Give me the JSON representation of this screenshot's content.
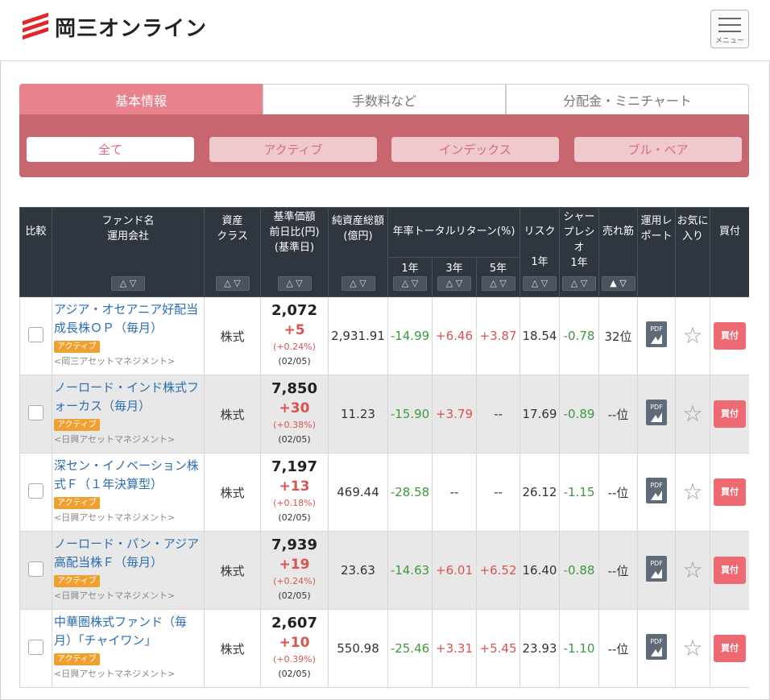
{
  "header": {
    "logo_text": "岡三オンライン",
    "menu_label": "メニュー"
  },
  "tabs": [
    {
      "label": "基本情報",
      "active": true
    },
    {
      "label": "手数料など",
      "active": false
    },
    {
      "label": "分配金・ミニチャート",
      "active": false
    }
  ],
  "filters": [
    {
      "label": "全て",
      "active": true
    },
    {
      "label": "アクティブ",
      "active": false
    },
    {
      "label": "インデックス",
      "active": false
    },
    {
      "label": "ブル・ベア",
      "active": false
    }
  ],
  "table": {
    "headers": {
      "compare": "比較",
      "fund_line1": "ファンド名",
      "fund_line2": "運用会社",
      "asset_line1": "資産",
      "asset_line2": "クラス",
      "nav_line1": "基準価額",
      "nav_line2": "前日比(円)",
      "nav_line3": "(基準日)",
      "assets_line1": "純資産総額",
      "assets_line2": "(億円)",
      "return_group": "年率トータルリターン(%)",
      "ret_1y": "1年",
      "ret_3y": "3年",
      "ret_5y": "5年",
      "risk_line1": "リスク",
      "risk_line2": "1年",
      "sharpe_line1": "シャー",
      "sharpe_line2": "プレシ",
      "sharpe_line3": "オ",
      "sharpe_line4": "1年",
      "ranking": "売れ筋",
      "report_line1": "運用レ",
      "report_line2": "ポート",
      "fav_line1": "お気に",
      "fav_line2": "入り",
      "buy": "買付",
      "sort_symbol": "△ ▽",
      "sort_active_symbol": "▲ ▽"
    },
    "rows": [
      {
        "name_line1": "アジア・オセアニア好配当",
        "name_line2": "成長株ＯＰ（毎月）",
        "badge": "アクティブ",
        "company": "<岡三アセットマネジメント>",
        "asset_class": "株式",
        "nav": "2,072",
        "change": "+5",
        "change_pct": "(+0.24%)",
        "date": "(02/05)",
        "net_assets": "2,931.91",
        "ret_1y": "-14.99",
        "ret_3y": "+6.46",
        "ret_5y": "+3.87",
        "risk": "18.54",
        "sharpe": "-0.78",
        "rank": "32位",
        "buy": "買付"
      },
      {
        "name_line1": "ノーロード・インド株式フ",
        "name_line2": "ォーカス（毎月）",
        "badge": "アクティブ",
        "company": "<日興アセットマネジメント>",
        "asset_class": "株式",
        "nav": "7,850",
        "change": "+30",
        "change_pct": "(+0.38%)",
        "date": "(02/05)",
        "net_assets": "11.23",
        "ret_1y": "-15.90",
        "ret_3y": "+3.79",
        "ret_5y": "--",
        "risk": "17.69",
        "sharpe": "-0.89",
        "rank": "--位",
        "buy": "買付"
      },
      {
        "name_line1": "深セン・イノベーション株",
        "name_line2": "式Ｆ（１年決算型）",
        "badge": "アクティブ",
        "company": "<日興アセットマネジメント>",
        "asset_class": "株式",
        "nav": "7,197",
        "change": "+13",
        "change_pct": "(+0.18%)",
        "date": "(02/05)",
        "net_assets": "469.44",
        "ret_1y": "-28.58",
        "ret_3y": "--",
        "ret_5y": "--",
        "risk": "26.12",
        "sharpe": "-1.15",
        "rank": "--位",
        "buy": "買付"
      },
      {
        "name_line1": "ノーロード・パン・アジア",
        "name_line2": "高配当株Ｆ（毎月）",
        "badge": "アクティブ",
        "company": "<日興アセットマネジメント>",
        "asset_class": "株式",
        "nav": "7,939",
        "change": "+19",
        "change_pct": "(+0.24%)",
        "date": "(02/05)",
        "net_assets": "23.63",
        "ret_1y": "-14.63",
        "ret_3y": "+6.01",
        "ret_5y": "+6.52",
        "risk": "16.40",
        "sharpe": "-0.88",
        "rank": "--位",
        "buy": "買付"
      },
      {
        "name_line1": "中華圏株式ファンド（毎",
        "name_line2": "月）「チャイワン」",
        "badge": "アクティブ",
        "company": "<日興アセットマネジメント>",
        "asset_class": "株式",
        "nav": "2,607",
        "change": "+10",
        "change_pct": "(+0.39%)",
        "date": "(02/05)",
        "net_assets": "550.98",
        "ret_1y": "-25.46",
        "ret_3y": "+3.31",
        "ret_5y": "+5.45",
        "risk": "23.93",
        "sharpe": "-1.10",
        "rank": "--位",
        "buy": "買付"
      }
    ]
  },
  "colors": {
    "accent": "#e8828c",
    "panel": "#c86670",
    "header_bg": "#2f3640",
    "negative": "#3c9a3c",
    "positive": "#d9534f",
    "link": "#2a6db5",
    "badge": "#f0a030",
    "buy": "#ee6a73"
  }
}
